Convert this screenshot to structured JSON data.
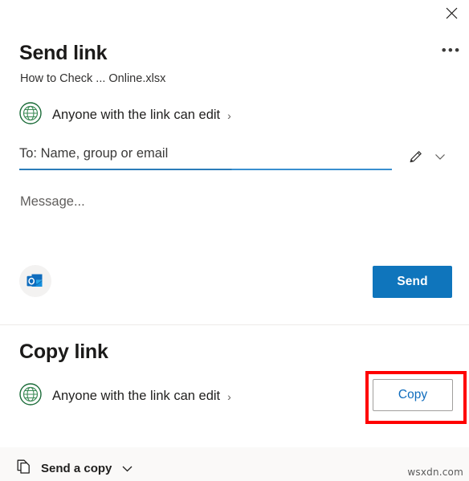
{
  "dialog": {
    "title": "Send link",
    "file_name": "How to Check ... Online.xlsx",
    "close_label": "✕",
    "more_options_label": "•••"
  },
  "send_link": {
    "permission": {
      "label": "Anyone with the link can edit",
      "chevron": "›",
      "icon": "globe-icon",
      "color": "#0b6a3a"
    },
    "to_field": {
      "placeholder": "To: Name, group or email",
      "value": "",
      "underline_color": "#2b7cb9"
    },
    "edit_icon": "pencil-icon",
    "expand_icon": "chevron-down-icon",
    "message_field": {
      "placeholder": "Message...",
      "value": ""
    },
    "outlook_icon": "outlook-icon",
    "send_button": {
      "label": "Send",
      "color": "#0f75bc"
    }
  },
  "copy_link": {
    "title": "Copy link",
    "permission": {
      "label": "Anyone with the link can edit",
      "chevron": "›",
      "icon": "globe-icon"
    },
    "copy_button": {
      "label": "Copy",
      "text_color": "#0f6cbd"
    },
    "highlight_color": "#ff0000"
  },
  "bottom_bar": {
    "send_a_copy": {
      "label": "Send a copy",
      "icon": "copy-pages-icon",
      "chevron": "chevron-down-icon"
    }
  },
  "watermark": {
    "text": "wsxdn.com"
  }
}
